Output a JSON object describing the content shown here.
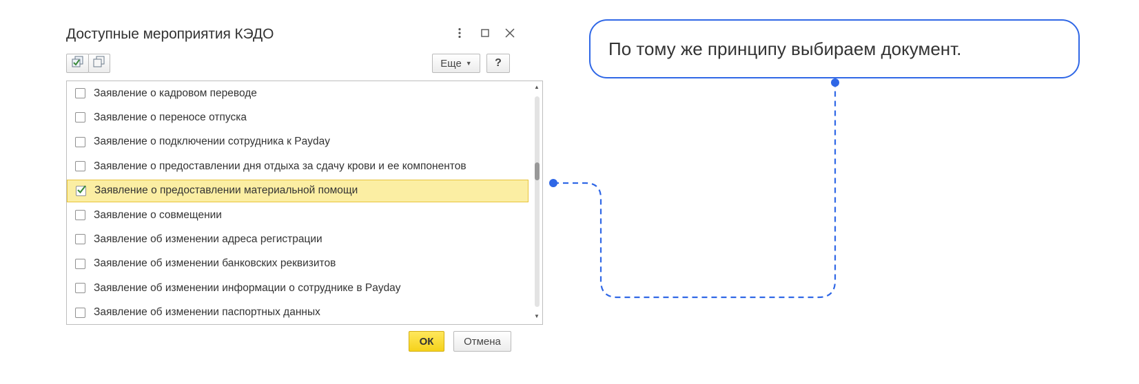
{
  "dialog": {
    "title": "Доступные мероприятия КЭДО",
    "title_buttons": {
      "more_icon": "vertical-dots-icon",
      "maximize_icon": "maximize-icon",
      "close_icon": "close-icon"
    },
    "toolbar": {
      "check_all_icon": "check-all-icon",
      "uncheck_all_icon": "uncheck-all-icon",
      "more_label": "Еще",
      "help_label": "?"
    },
    "items": [
      {
        "label": "Заявление о кадровом переводе",
        "checked": false
      },
      {
        "label": "Заявление о переносе отпуска",
        "checked": false
      },
      {
        "label": "Заявление о подключении сотрудника к Payday",
        "checked": false
      },
      {
        "label": "Заявление о предоставлении дня отдыха за сдачу крови и ее компонентов",
        "checked": false
      },
      {
        "label": "Заявление о предоставлении материальной помощи",
        "checked": true
      },
      {
        "label": "Заявление о совмещении",
        "checked": false
      },
      {
        "label": "Заявление об изменении адреса регистрации",
        "checked": false
      },
      {
        "label": "Заявление об изменении банковских реквизитов",
        "checked": false
      },
      {
        "label": "Заявление об изменении информации о сотруднике в Payday",
        "checked": false
      },
      {
        "label": "Заявление об изменении паспортных данных",
        "checked": false
      }
    ],
    "ok_label": "ОК",
    "cancel_label": "Отмена"
  },
  "callout": {
    "text": "По тому же принципу выбираем документ."
  },
  "colors": {
    "accent": "#2f67e6",
    "selection_bg": "#fbeea3",
    "ok_button": "#f5d21b",
    "checkmark": "#3a8a3a"
  }
}
